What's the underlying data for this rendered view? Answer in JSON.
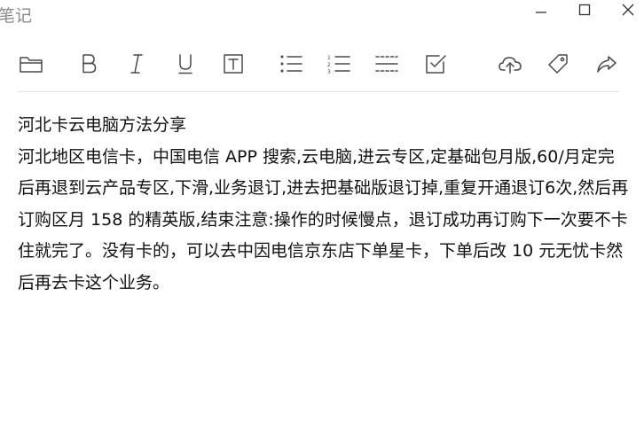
{
  "window": {
    "title": "笔记"
  },
  "toolbar": {
    "buttons": [
      {
        "name": "folder",
        "icon": "folder-icon"
      },
      {
        "name": "bold",
        "icon": "bold-icon"
      },
      {
        "name": "italic",
        "icon": "italic-icon"
      },
      {
        "name": "underline",
        "icon": "underline-icon"
      },
      {
        "name": "text",
        "icon": "text-box-icon"
      },
      {
        "name": "bullet-list",
        "icon": "bullet-list-icon"
      },
      {
        "name": "numbered-list",
        "icon": "numbered-list-icon"
      },
      {
        "name": "divider",
        "icon": "dashed-divider-icon"
      },
      {
        "name": "checkbox",
        "icon": "checkbox-icon"
      },
      {
        "name": "upload",
        "icon": "cloud-upload-icon"
      },
      {
        "name": "tag",
        "icon": "tag-icon"
      },
      {
        "name": "share",
        "icon": "share-icon"
      }
    ]
  },
  "note": {
    "title": "河北卡云电脑方法分享",
    "body": "河北地区电信卡，中国电信 APP 搜索,云电脑,进云专区,定基础包月版,60/月定完后再退到云产品专区,下滑,业务退订,进去把基础版退订掉,重复开通退订6次,然后再订购区月 158 的精英版,结束注意:操作的时候慢点，退订成功再订购下一次要不卡住就完了。没有卡的，可以去中因电信京东店下单星卡，下单后改 10 元无忧卡然后再去卡这个业务。"
  }
}
